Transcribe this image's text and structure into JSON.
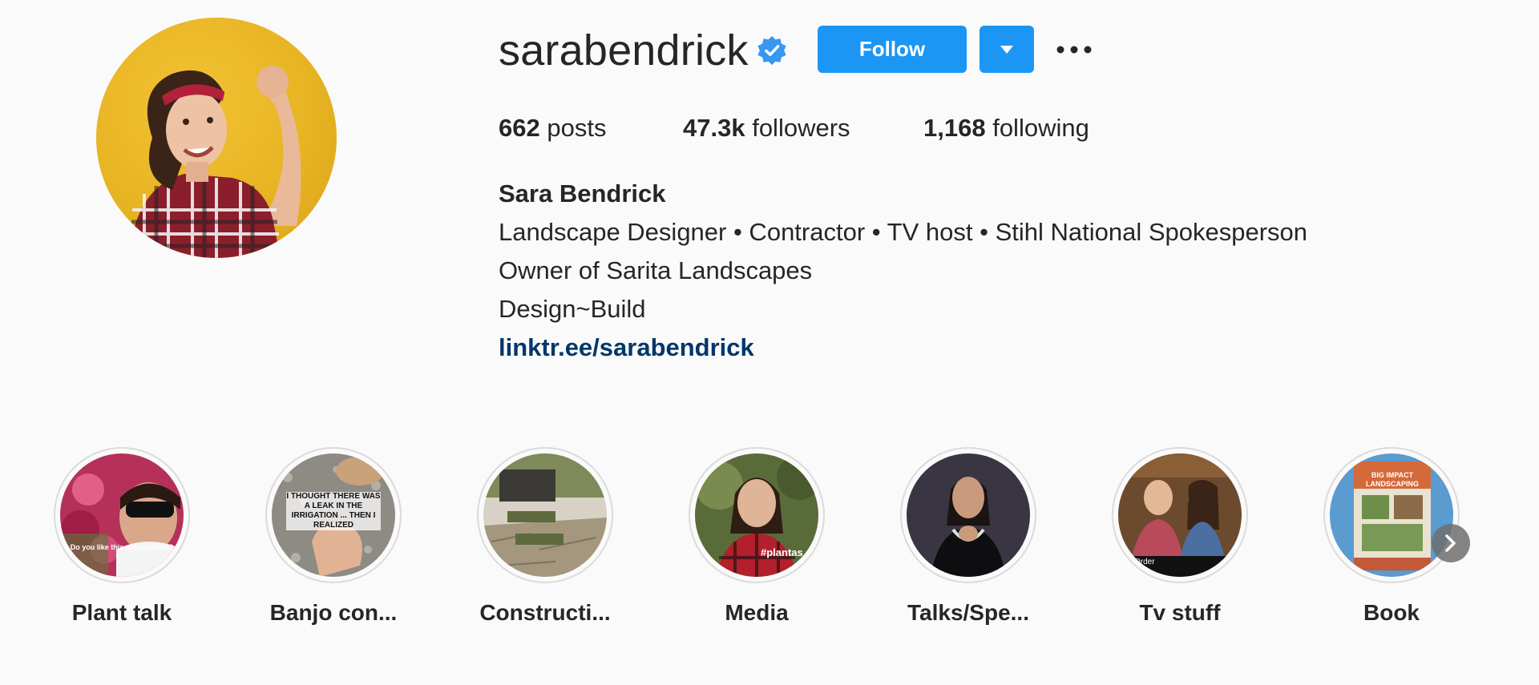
{
  "profile": {
    "username": "sarabendrick",
    "verified_icon": "verified-badge-icon",
    "follow_label": "Follow",
    "dropdown_icon": "caret-down-icon",
    "more_icon": "more-horizontal-icon",
    "accent_color": "#1c96f4"
  },
  "stats": {
    "posts_count": "662",
    "posts_label": "posts",
    "followers_count": "47.3k",
    "followers_label": "followers",
    "following_count": "1,168",
    "following_label": "following"
  },
  "bio": {
    "name": "Sara Bendrick",
    "line1": "Landscape Designer • Contractor • TV host • Stihl National Spokesperson",
    "line2": "Owner of Sarita Landscapes",
    "line3": "Design~Build",
    "link": "linktr.ee/sarabendrick",
    "link_color": "#00376b"
  },
  "highlights": [
    {
      "label": "Plant talk",
      "overlay": "Do you like this color combo?"
    },
    {
      "label": "Banjo con...",
      "overlay": "I THOUGHT THERE WAS A LEAK IN THE IRRIGATION ... THEN I REALIZED"
    },
    {
      "label": "Constructi..."
    },
    {
      "label": "Media",
      "overlay": "#plantas"
    },
    {
      "label": "Talks/Spe..."
    },
    {
      "label": "Tv stuff",
      "overlay": "Order"
    },
    {
      "label": "Book",
      "overlay": "BIG IMPACT LANDSCAPING"
    }
  ],
  "highlights_next_icon": "chevron-right-icon"
}
